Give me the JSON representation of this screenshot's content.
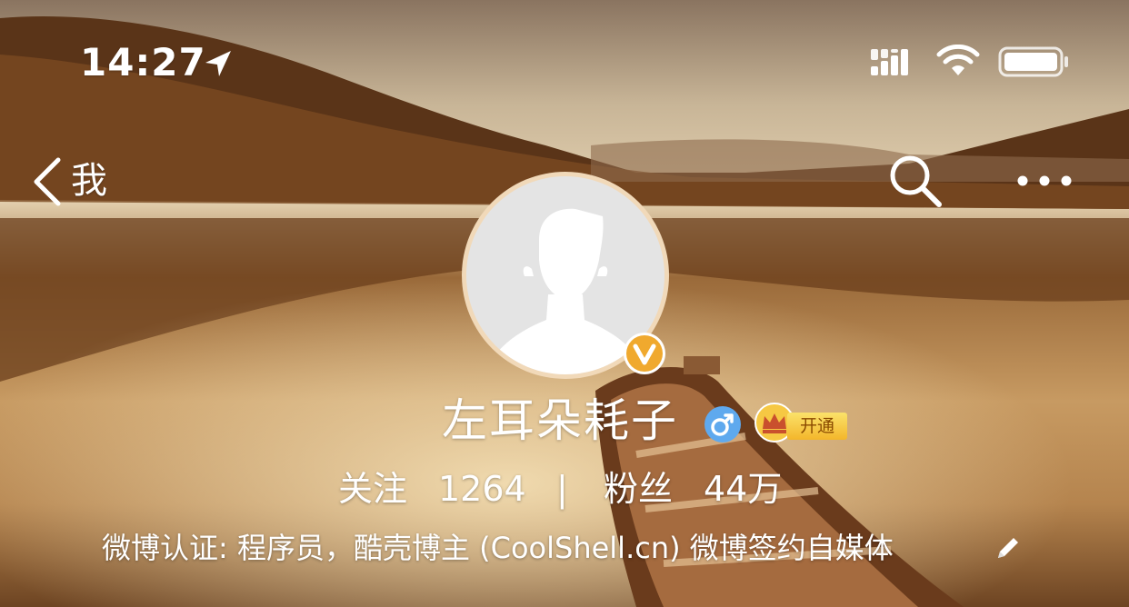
{
  "status_bar": {
    "time": "14:27",
    "icons": [
      "location-arrow-icon",
      "signal-icon",
      "wifi-icon",
      "battery-icon"
    ]
  },
  "nav": {
    "back_label": "我",
    "icons": [
      "chevron-left-icon",
      "search-icon",
      "more-icon"
    ]
  },
  "profile": {
    "name": "左耳朵耗子",
    "gender_icon": "male-icon",
    "verified_icon": "verified-v-icon",
    "vip": {
      "crown_icon": "crown-icon",
      "open_label": "开通"
    },
    "stats": {
      "follow_label": "关注",
      "follow_count": "1264",
      "divider": "|",
      "fans_label": "粉丝",
      "fans_count": "44万"
    },
    "verification_text": "微博认证: 程序员，酷壳博主 (CoolShell.cn) 微博签约自媒体"
  },
  "colors": {
    "verified_badge": "#f0a92e",
    "gender_badge": "#5fa9ee",
    "vip_badge": "#f6c843",
    "text": "#ffffff"
  }
}
